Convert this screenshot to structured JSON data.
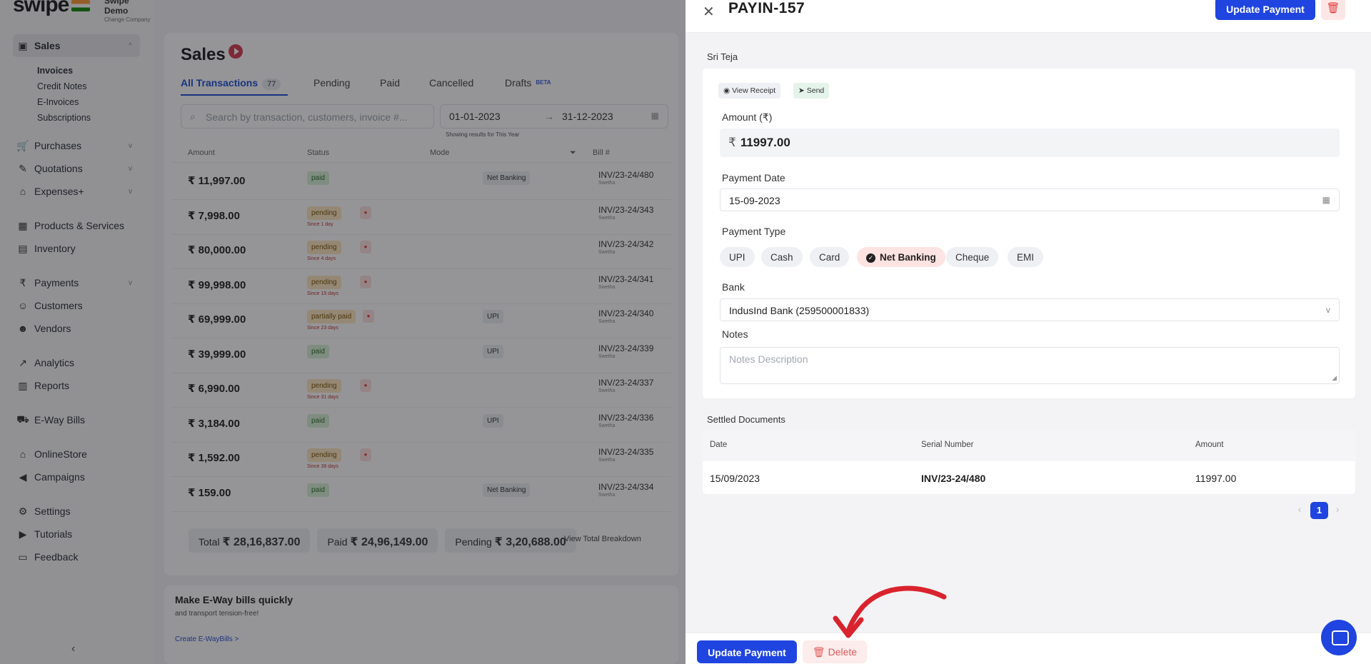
{
  "brand": {
    "name": "swipe",
    "company": "Swipe Demo",
    "company_sub": "Change Company"
  },
  "sidebar": {
    "sales": "Sales",
    "sales_sub": [
      "Invoices",
      "Credit Notes",
      "E-Invoices",
      "Subscriptions"
    ],
    "items": [
      {
        "label": "Purchases",
        "icon": "cart-icon"
      },
      {
        "label": "Quotations",
        "icon": "pencil-icon"
      },
      {
        "label": "Expenses+",
        "icon": "tag-icon"
      },
      {
        "label": "Products & Services",
        "icon": "box-icon"
      },
      {
        "label": "Inventory",
        "icon": "warehouse-icon"
      },
      {
        "label": "Payments",
        "icon": "rupee-icon"
      },
      {
        "label": "Customers",
        "icon": "user-icon"
      },
      {
        "label": "Vendors",
        "icon": "users-icon"
      },
      {
        "label": "Analytics",
        "icon": "chart-icon"
      },
      {
        "label": "Reports",
        "icon": "report-icon"
      },
      {
        "label": "E-Way Bills",
        "icon": "truck-icon"
      },
      {
        "label": "OnlineStore",
        "icon": "store-icon"
      },
      {
        "label": "Campaigns",
        "icon": "megaphone-icon"
      },
      {
        "label": "Settings",
        "icon": "gear-icon"
      },
      {
        "label": "Tutorials",
        "icon": "youtube-icon"
      },
      {
        "label": "Feedback",
        "icon": "chat-icon"
      }
    ]
  },
  "sales_page": {
    "title": "Sales",
    "tabs": [
      {
        "label": "All Transactions",
        "count": "77"
      },
      {
        "label": "Pending"
      },
      {
        "label": "Paid"
      },
      {
        "label": "Cancelled"
      },
      {
        "label": "Drafts",
        "badge": "BETA"
      }
    ],
    "search_placeholder": "Search by transaction, customers, invoice #...",
    "date_from": "01-01-2023",
    "date_to": "31-12-2023",
    "date_hint": "Showing results for This Year",
    "columns": [
      "Amount",
      "Status",
      "Mode",
      "Bill #"
    ],
    "rows": [
      {
        "amount": "₹ 11,997.00",
        "status": "paid",
        "mode": "Net Banking",
        "bill": "INV/23-24/480",
        "sub": "Swetha"
      },
      {
        "amount": "₹ 7,998.00",
        "status": "pending",
        "since": "Since 1 day",
        "bill": "INV/23-24/343",
        "sub": "Swetha"
      },
      {
        "amount": "₹ 80,000.00",
        "status": "pending",
        "since": "Since 4 days",
        "bill": "INV/23-24/342",
        "sub": "Swetha"
      },
      {
        "amount": "₹ 99,998.00",
        "status": "pending",
        "since": "Since 15 days",
        "bill": "INV/23-24/341",
        "sub": "Swetha"
      },
      {
        "amount": "₹ 69,999.00",
        "status": "partially paid",
        "since": "Since 23 days",
        "mode": "UPI",
        "bill": "INV/23-24/340",
        "sub": "Swetha"
      },
      {
        "amount": "₹ 39,999.00",
        "status": "paid",
        "mode": "UPI",
        "bill": "INV/23-24/339",
        "sub": "Swetha"
      },
      {
        "amount": "₹ 6,990.00",
        "status": "pending",
        "since": "Since 31 days",
        "bill": "INV/23-24/337",
        "sub": "Swetha"
      },
      {
        "amount": "₹ 3,184.00",
        "status": "paid",
        "mode": "UPI",
        "bill": "INV/23-24/336",
        "sub": "Swetha"
      },
      {
        "amount": "₹ 1,592.00",
        "status": "pending",
        "since": "Since 38 days",
        "bill": "INV/23-24/335",
        "sub": "Swetha"
      },
      {
        "amount": "₹ 159.00",
        "status": "paid",
        "mode": "Net Banking",
        "bill": "INV/23-24/334",
        "sub": "Swetha"
      }
    ],
    "totals": {
      "total_label": "Total",
      "total": "₹ 28,16,837.00",
      "paid_label": "Paid",
      "paid": "₹ 24,96,149.00",
      "pending_label": "Pending",
      "pending": "₹ 3,20,688.00",
      "breakdown_link": "View Total Breakdown"
    }
  },
  "promo": {
    "title": "Make E-Way bills quickly",
    "subtitle": "and transport tension-free!",
    "link": "Create E-WayBills >"
  },
  "drawer": {
    "title": "PAYIN-157",
    "update_label": "Update Payment",
    "delete_label": "Delete",
    "party": "Sri Teja",
    "view_receipt": "View Receipt",
    "send": "Send",
    "amount_label": "Amount (₹)",
    "amount_symbol": "₹",
    "amount_value": "11997.00",
    "date_label": "Payment Date",
    "date_value": "15-09-2023",
    "type_label": "Payment Type",
    "types": [
      "UPI",
      "Cash",
      "Card",
      "Net Banking",
      "Cheque",
      "EMI"
    ],
    "selected_type": "Net Banking",
    "bank_label": "Bank",
    "bank_value": "IndusInd Bank (259500001833)",
    "notes_label": "Notes",
    "notes_placeholder": "Notes Description",
    "settled_title": "Settled Documents",
    "settled_columns": [
      "Date",
      "Serial Number",
      "Amount"
    ],
    "settled_rows": [
      {
        "date": "15/09/2023",
        "serial": "INV/23-24/480",
        "amount": "11997.00"
      }
    ],
    "page": "1"
  },
  "colors": {
    "accent": "#1f44e0",
    "danger": "#e23b3b",
    "arrow": "#d9232d"
  }
}
